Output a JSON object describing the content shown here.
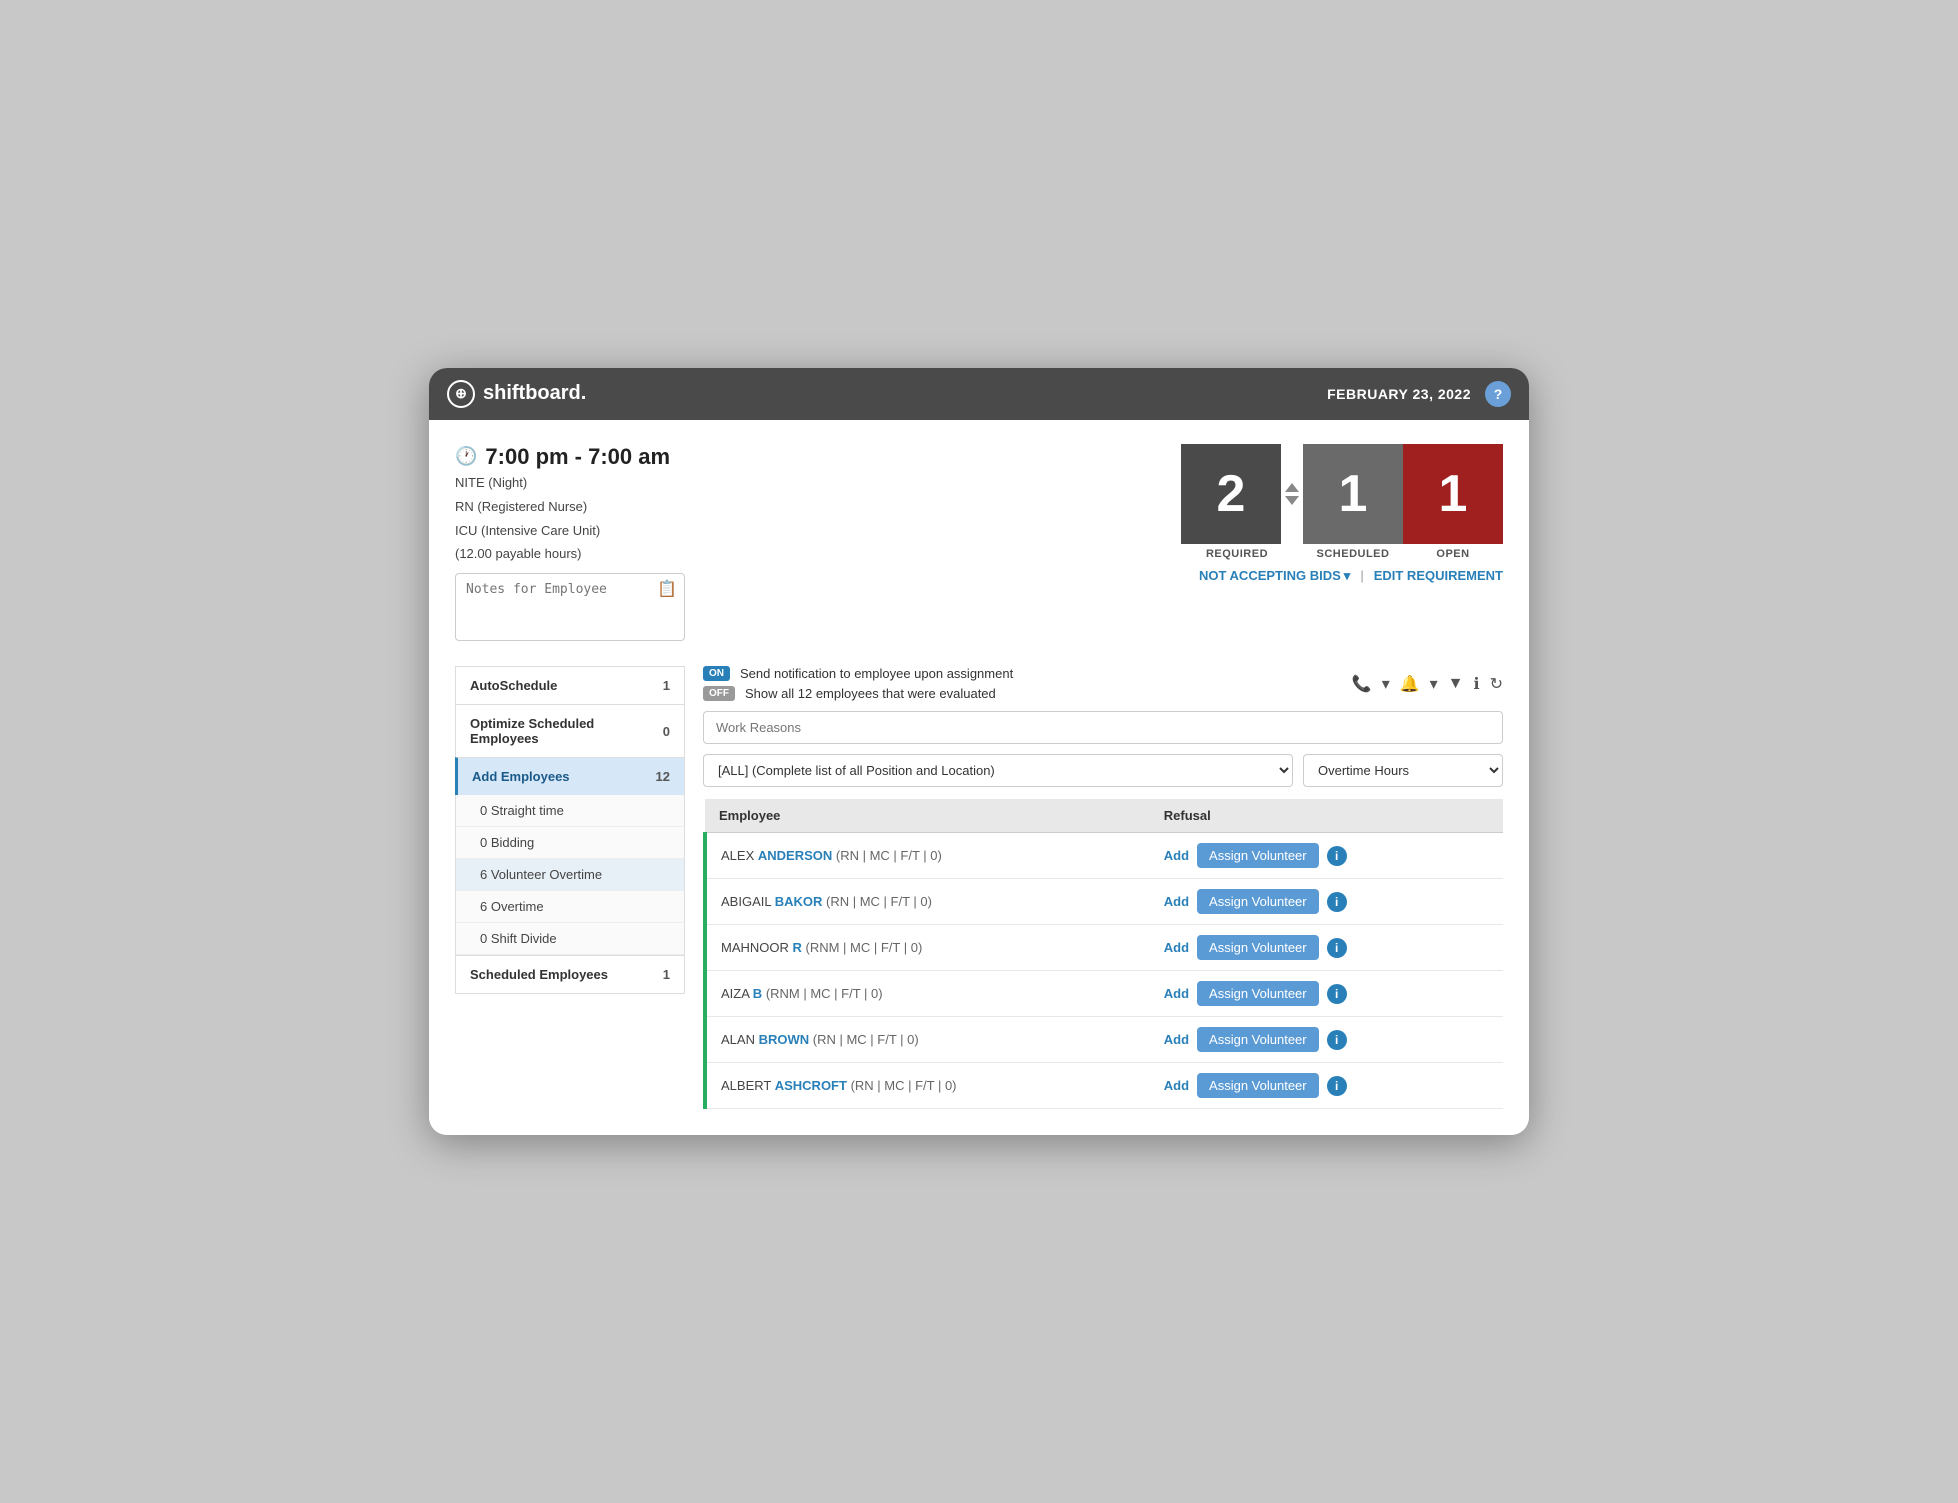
{
  "header": {
    "logo_text": "shiftboard.",
    "date": "FEBRUARY 23, 2022",
    "help_label": "?"
  },
  "shift": {
    "time": "7:00 pm - 7:00 am",
    "type": "NITE (Night)",
    "role": "RN (Registered Nurse)",
    "unit": "ICU (Intensive Care Unit)",
    "payable": "(12.00 payable hours)"
  },
  "notes_placeholder": "Notes for Employee",
  "stats": {
    "required": "2",
    "scheduled": "1",
    "open": "1",
    "required_label": "REQUIRED",
    "scheduled_label": "SCHEDULED",
    "open_label": "OPEN"
  },
  "bid_actions": {
    "not_accepting": "NOT ACCEPTING BIDS",
    "edit": "EDIT REQUIREMENT"
  },
  "left_panel": {
    "items": [
      {
        "label": "AutoSchedule",
        "count": "1",
        "active": false
      },
      {
        "label": "Optimize Scheduled Employees",
        "count": "0",
        "active": false
      },
      {
        "label": "Add Employees",
        "count": "12",
        "active": true
      },
      {
        "label": "Scheduled Employees",
        "count": "1",
        "active": false
      }
    ],
    "sub_items": [
      {
        "label": "0 Straight time",
        "highlighted": false
      },
      {
        "label": "0 Bidding",
        "highlighted": false
      },
      {
        "label": "6 Volunteer Overtime",
        "highlighted": true
      },
      {
        "label": "6 Overtime",
        "highlighted": false
      },
      {
        "label": "0 Shift Divide",
        "highlighted": false
      }
    ]
  },
  "notifications": {
    "on_label": "ON",
    "on_text": "Send notification to employee upon assignment",
    "off_label": "OFF",
    "off_text": "Show all 12 employees that were evaluated"
  },
  "work_reasons_placeholder": "Work Reasons",
  "filter": {
    "position_option": "[ALL] (Complete list of all Position and Location)",
    "sort_option": "Overtime Hours"
  },
  "table": {
    "col_employee": "Employee",
    "col_refusal": "Refusal",
    "rows": [
      {
        "first": "ALEX ",
        "last": "ANDERSON",
        "details": "(RN | MC | F/T | 0)",
        "add_label": "Add",
        "assign_label": "Assign Volunteer"
      },
      {
        "first": "ABIGAIL ",
        "last": "BAKOR",
        "details": "(RN | MC | F/T | 0)",
        "add_label": "Add",
        "assign_label": "Assign Volunteer"
      },
      {
        "first": "MAHNOOR ",
        "last": "R",
        "details": "(RNM | MC | F/T | 0)",
        "add_label": "Add",
        "assign_label": "Assign Volunteer"
      },
      {
        "first": "AIZA ",
        "last": "B",
        "details": "(RNM | MC | F/T | 0)",
        "add_label": "Add",
        "assign_label": "Assign Volunteer"
      },
      {
        "first": "ALAN ",
        "last": "BROWN",
        "details": "(RN | MC | F/T | 0)",
        "add_label": "Add",
        "assign_label": "Assign Volunteer"
      },
      {
        "first": "ALBERT ",
        "last": "ASHCROFT",
        "details": "(RN | MC | F/T | 0)",
        "add_label": "Add",
        "assign_label": "Assign Volunteer"
      }
    ]
  }
}
